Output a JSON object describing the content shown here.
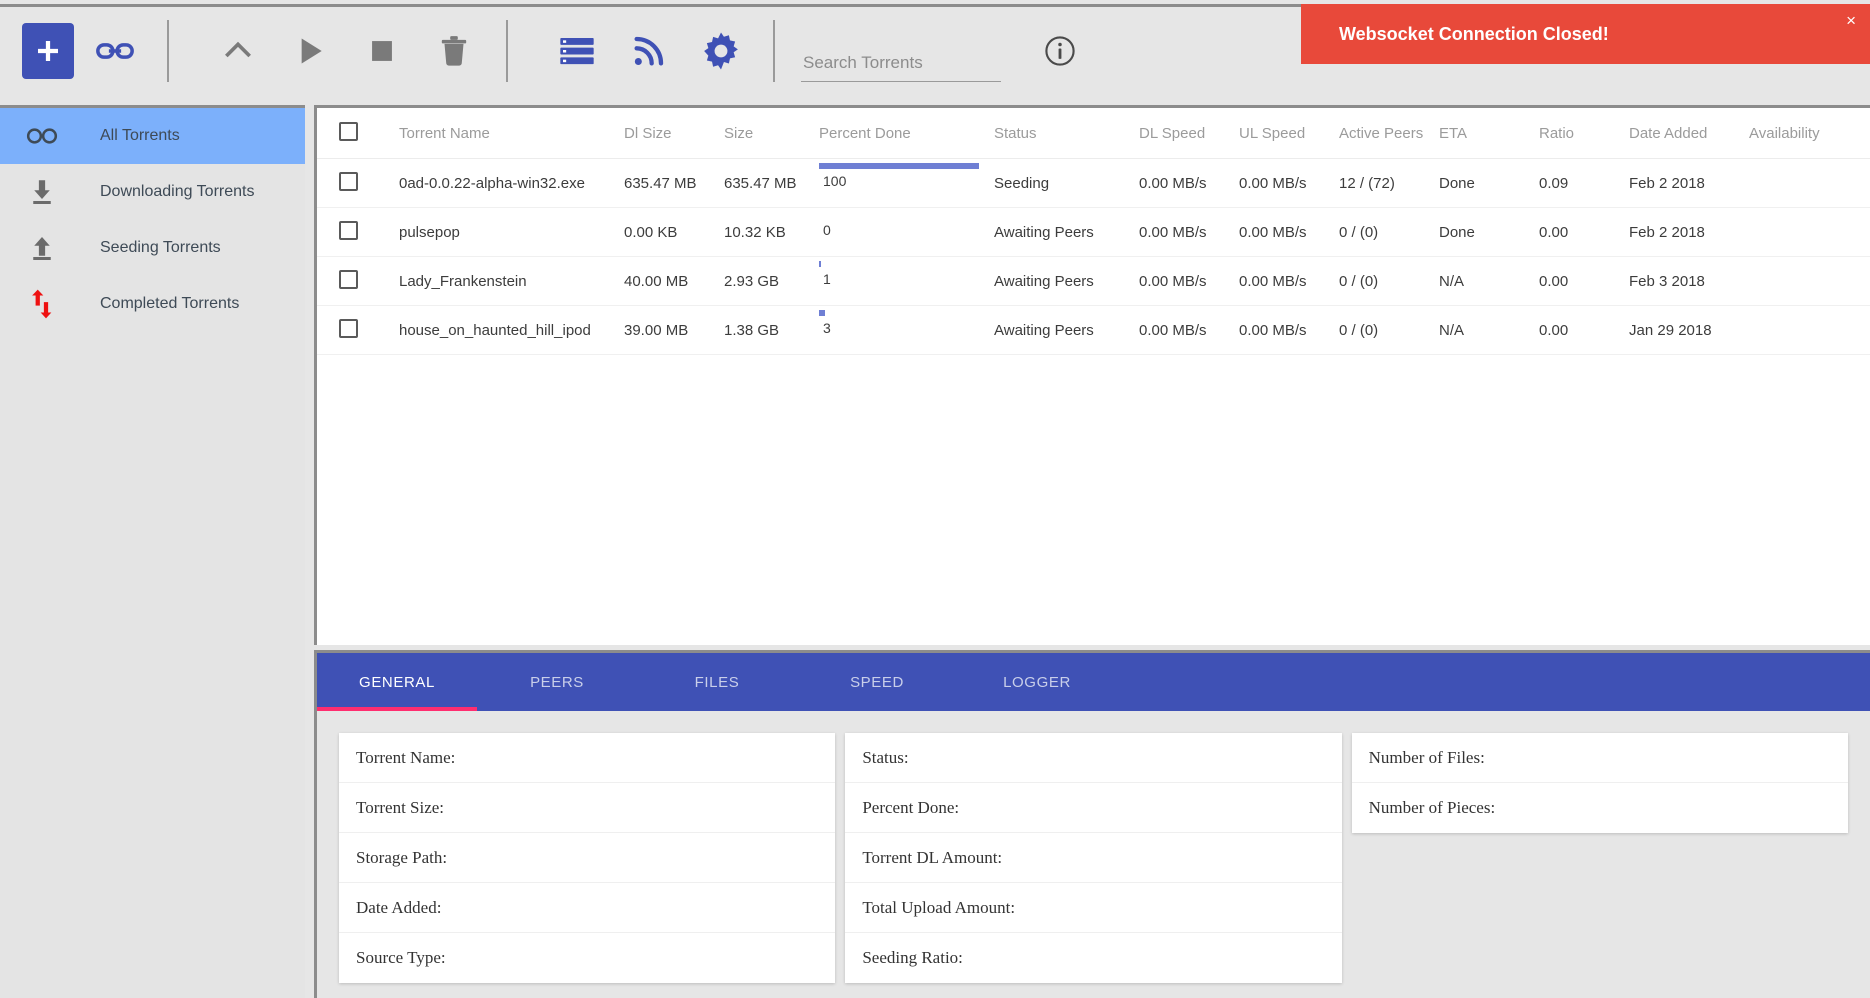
{
  "toolbar": {
    "buttons": [
      {
        "name": "add-torrent-button",
        "icon": "plus-icon",
        "label": "Add Torrent"
      },
      {
        "name": "add-magnet-button",
        "icon": "link-icon",
        "label": "Add Magnet Link"
      },
      {
        "name": "move-up-button",
        "icon": "chevron-up-icon",
        "label": "Move Up"
      },
      {
        "name": "start-button",
        "icon": "play-icon",
        "label": "Start"
      },
      {
        "name": "stop-button",
        "icon": "stop-icon",
        "label": "Stop"
      },
      {
        "name": "delete-button",
        "icon": "trash-icon",
        "label": "Delete"
      },
      {
        "name": "list-view-button",
        "icon": "list-icon",
        "label": "List View"
      },
      {
        "name": "rss-button",
        "icon": "rss-icon",
        "label": "RSS"
      },
      {
        "name": "settings-button",
        "icon": "gear-icon",
        "label": "Settings"
      }
    ],
    "info_icon": "info-icon"
  },
  "search": {
    "placeholder": "Search Torrents",
    "value": ""
  },
  "notification": {
    "message": "Websocket Connection Closed!",
    "close_label": "×",
    "color": "#e8493a"
  },
  "sidebar": {
    "items": [
      {
        "label": "All Torrents",
        "icon": "infinity-icon",
        "active": true
      },
      {
        "label": "Downloading Torrents",
        "icon": "download-arrow-icon",
        "active": false
      },
      {
        "label": "Seeding Torrents",
        "icon": "upload-arrow-icon",
        "active": false
      },
      {
        "label": "Completed Torrents",
        "icon": "up-down-arrows-icon",
        "active": false
      }
    ],
    "active_color": "#7cb0fb"
  },
  "table": {
    "headers": [
      "Torrent Name",
      "Dl Size",
      "Size",
      "Percent Done",
      "Status",
      "DL Speed",
      "UL Speed",
      "Active Peers",
      "ETA",
      "Ratio",
      "Date Added",
      "Availability"
    ],
    "rows": [
      {
        "checked": false,
        "name": "0ad-0.0.22-alpha-win32.exe",
        "dl_size": "635.47 MB",
        "size": "635.47 MB",
        "percent": "100",
        "percent_value": 100,
        "status": "Seeding",
        "dl_speed": "0.00 MB/s",
        "ul_speed": "0.00 MB/s",
        "active_peers": "12 / (72)",
        "eta": "Done",
        "ratio": "0.09",
        "date_added": "Feb 2 2018",
        "availability": ""
      },
      {
        "checked": false,
        "name": "pulsepop",
        "dl_size": "0.00 KB",
        "size": "10.32 KB",
        "percent": "0",
        "percent_value": 0,
        "status": "Awaiting Peers",
        "dl_speed": "0.00 MB/s",
        "ul_speed": "0.00 MB/s",
        "active_peers": "0 / (0)",
        "eta": "Done",
        "ratio": "0.00",
        "date_added": "Feb 2 2018",
        "availability": ""
      },
      {
        "checked": false,
        "name": "Lady_Frankenstein",
        "dl_size": "40.00 MB",
        "size": "2.93 GB",
        "percent": "1",
        "percent_value": 1,
        "status": "Awaiting Peers",
        "dl_speed": "0.00 MB/s",
        "ul_speed": "0.00 MB/s",
        "active_peers": "0 / (0)",
        "eta": "N/A",
        "ratio": "0.00",
        "date_added": "Feb 3 2018",
        "availability": ""
      },
      {
        "checked": false,
        "name": "house_on_haunted_hill_ipod",
        "dl_size": "39.00 MB",
        "size": "1.38 GB",
        "percent": "3",
        "percent_value": 3,
        "status": "Awaiting Peers",
        "dl_speed": "0.00 MB/s",
        "ul_speed": "0.00 MB/s",
        "active_peers": "0 / (0)",
        "eta": "N/A",
        "ratio": "0.00",
        "date_added": "Jan 29 2018",
        "availability": ""
      }
    ]
  },
  "detail": {
    "tabs": [
      {
        "label": "GENERAL",
        "active": true
      },
      {
        "label": "PEERS",
        "active": false
      },
      {
        "label": "FILES",
        "active": false
      },
      {
        "label": "SPEED",
        "active": false
      },
      {
        "label": "LOGGER",
        "active": false
      }
    ],
    "active_underline_color": "#ff2d6f",
    "column1": [
      "Torrent Name:",
      "Torrent Size:",
      "Storage Path:",
      "Date Added:",
      "Source Type:"
    ],
    "column2": [
      "Status:",
      "Percent Done:",
      "Torrent DL Amount:",
      "Total Upload Amount:",
      "Seeding Ratio:"
    ],
    "column3": [
      "Number of Files:",
      "Number of Pieces:"
    ]
  }
}
